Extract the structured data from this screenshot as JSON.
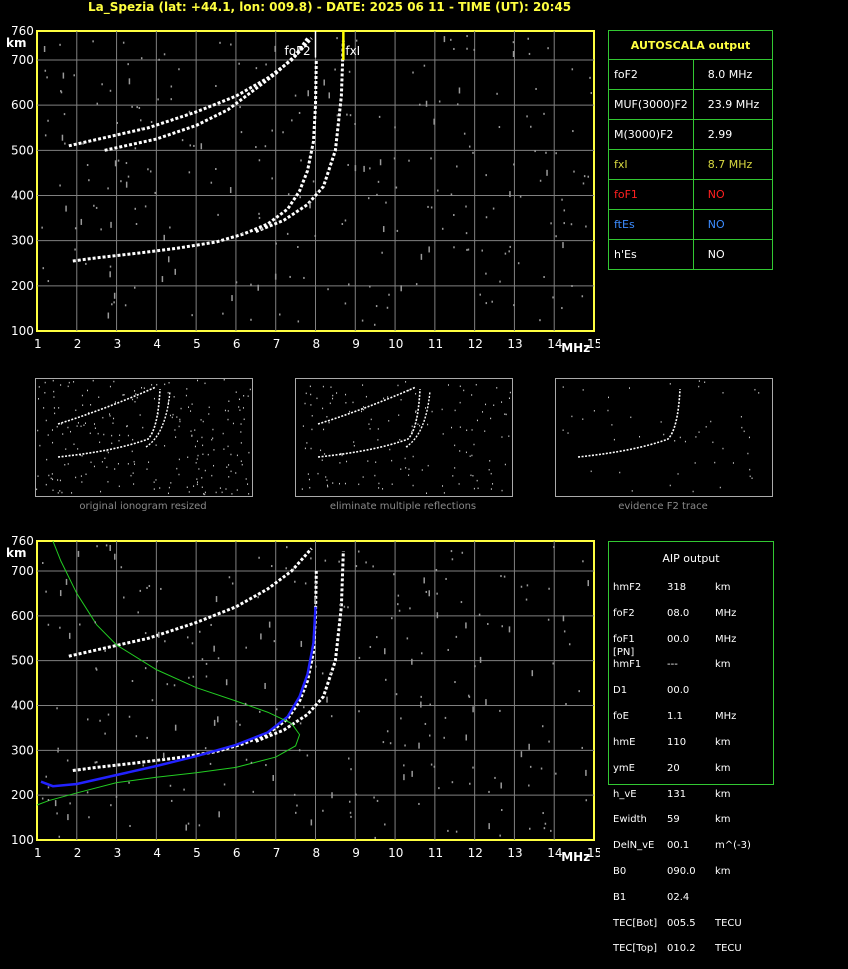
{
  "header": "La_Spezia (lat: +44.1, lon: 009.8) - DATE: 2025 06 11 - TIME (UT): 20:45",
  "axes": {
    "y_unit": "km",
    "x_unit": "MHz",
    "y_ticks": [
      "760",
      "700",
      "600",
      "500",
      "400",
      "300",
      "200",
      "100"
    ],
    "x_ticks": [
      "1",
      "2",
      "3",
      "4",
      "5",
      "6",
      "7",
      "8",
      "9",
      "10",
      "11",
      "12",
      "13",
      "14",
      "15"
    ]
  },
  "chart_data": [
    {
      "type": "scatter",
      "title": "",
      "xlabel": "MHz",
      "ylabel": "km",
      "xlim": [
        1,
        15
      ],
      "ylim": [
        100,
        760
      ],
      "grid": true,
      "markers": {
        "foF2_label": "foF2",
        "fxI_label": "fxI",
        "foF2": 8.0,
        "fxI": 8.7
      },
      "series": [
        {
          "color": "#ffffff",
          "points": [
            [
              1.9,
              255
            ],
            [
              2.5,
              262
            ],
            [
              3.5,
              272
            ],
            [
              4.5,
              283
            ],
            [
              5.5,
              297
            ],
            [
              6.2,
              315
            ],
            [
              6.8,
              337
            ],
            [
              7.3,
              370
            ],
            [
              7.6,
              410
            ],
            [
              7.8,
              455
            ],
            [
              7.95,
              520
            ],
            [
              8.0,
              600
            ],
            [
              8.02,
              700
            ]
          ]
        },
        {
          "color": "#ffffff",
          "points": [
            [
              2.7,
              500
            ],
            [
              4.0,
              525
            ],
            [
              5.0,
              555
            ],
            [
              5.8,
              590
            ],
            [
              6.4,
              630
            ],
            [
              7.0,
              670
            ],
            [
              7.5,
              710
            ],
            [
              7.8,
              745
            ]
          ]
        },
        {
          "color": "#ffffff",
          "points": [
            [
              1.8,
              510
            ],
            [
              2.8,
              530
            ],
            [
              3.8,
              550
            ],
            [
              5.0,
              585
            ],
            [
              6.0,
              620
            ],
            [
              6.8,
              660
            ],
            [
              7.4,
              700
            ],
            [
              7.9,
              745
            ]
          ]
        },
        {
          "color": "#ffffff",
          "points": [
            [
              6.5,
              320
            ],
            [
              7.2,
              345
            ],
            [
              7.8,
              380
            ],
            [
              8.2,
              420
            ],
            [
              8.5,
              500
            ],
            [
              8.65,
              620
            ],
            [
              8.7,
              740
            ]
          ]
        }
      ]
    },
    {
      "type": "line",
      "title": "",
      "xlabel": "MHz",
      "ylabel": "km",
      "xlim": [
        1,
        15
      ],
      "ylim": [
        100,
        760
      ],
      "grid": true,
      "series": [
        {
          "color": "#ffffff",
          "points": [
            [
              1.9,
              255
            ],
            [
              2.5,
              262
            ],
            [
              3.5,
              272
            ],
            [
              4.5,
              283
            ],
            [
              5.5,
              297
            ],
            [
              6.2,
              315
            ],
            [
              6.8,
              337
            ],
            [
              7.3,
              370
            ],
            [
              7.6,
              410
            ],
            [
              7.8,
              455
            ],
            [
              7.95,
              520
            ],
            [
              8.0,
              600
            ],
            [
              8.02,
              700
            ]
          ]
        },
        {
          "color": "#ffffff",
          "points": [
            [
              1.8,
              510
            ],
            [
              2.8,
              530
            ],
            [
              3.8,
              550
            ],
            [
              5.0,
              585
            ],
            [
              6.0,
              620
            ],
            [
              6.8,
              660
            ],
            [
              7.4,
              700
            ],
            [
              7.9,
              745
            ]
          ]
        },
        {
          "color": "#ffffff",
          "points": [
            [
              6.5,
              320
            ],
            [
              7.2,
              345
            ],
            [
              7.8,
              380
            ],
            [
              8.2,
              420
            ],
            [
              8.5,
              500
            ],
            [
              8.65,
              620
            ],
            [
              8.7,
              740
            ]
          ]
        },
        {
          "color": "#2222ff",
          "points": [
            [
              1.1,
              230
            ],
            [
              1.4,
              220
            ],
            [
              2,
              225
            ],
            [
              3,
              245
            ],
            [
              4,
              265
            ],
            [
              5,
              287
            ],
            [
              6,
              312
            ],
            [
              6.8,
              340
            ],
            [
              7.3,
              375
            ],
            [
              7.6,
              420
            ],
            [
              7.8,
              470
            ],
            [
              7.95,
              540
            ],
            [
              8.0,
              620
            ]
          ]
        },
        {
          "color": "#22cc22",
          "points": [
            [
              1.4,
              760
            ],
            [
              1.6,
              720
            ],
            [
              2.0,
              650
            ],
            [
              2.5,
              580
            ],
            [
              3,
              535
            ],
            [
              4,
              480
            ],
            [
              5,
              440
            ],
            [
              6,
              410
            ],
            [
              6.8,
              385
            ],
            [
              7.4,
              360
            ],
            [
              7.6,
              335
            ],
            [
              7.5,
              310
            ],
            [
              7,
              285
            ],
            [
              6,
              262
            ],
            [
              5,
              250
            ],
            [
              4,
              240
            ],
            [
              3,
              228
            ],
            [
              2,
              205
            ],
            [
              1.3,
              188
            ],
            [
              1,
              178
            ]
          ]
        }
      ]
    }
  ],
  "thumbnails": [
    {
      "caption": "original ionogram resized"
    },
    {
      "caption": "eliminate multiple reflections"
    },
    {
      "caption": "evidence F2 trace"
    }
  ],
  "autoscala": {
    "title": "AUTOSCALA output",
    "rows": [
      {
        "label": "foF2",
        "value": "8.0 MHz",
        "color": "#ffffff"
      },
      {
        "label": "MUF(3000)F2",
        "value": "23.9 MHz",
        "color": "#ffffff"
      },
      {
        "label": "M(3000)F2",
        "value": "2.99",
        "color": "#ffffff"
      },
      {
        "label": "fxI",
        "value": "8.7 MHz",
        "color": "#d8d840"
      },
      {
        "label": "foF1",
        "value": "NO",
        "color": "#ff2020"
      },
      {
        "label": "ftEs",
        "value": "NO",
        "color": "#3c8cff"
      },
      {
        "label": "h'Es",
        "value": "NO",
        "color": "#ffffff"
      }
    ]
  },
  "aip": {
    "title": "AIP output",
    "rows": [
      [
        "hmF2",
        "318",
        "km",
        ""
      ],
      [
        "foF2",
        "08.0",
        "MHz",
        ""
      ],
      [
        "foF1",
        "00.0",
        "MHz",
        "[PN]"
      ],
      [
        "hmF1",
        "---",
        "km",
        ""
      ],
      [
        "D1",
        "00.0",
        "",
        ""
      ],
      [
        "foE",
        "1.1",
        "MHz",
        ""
      ],
      [
        "hmE",
        "110",
        "km",
        ""
      ],
      [
        "ymE",
        "20",
        "km",
        ""
      ],
      [
        "h_vE",
        "131",
        "km",
        ""
      ],
      [
        "Ewidth",
        "59",
        "km",
        ""
      ],
      [
        "DelN_vE",
        "00.1",
        "m^(-3)",
        ""
      ],
      [
        "B0",
        "090.0",
        "km",
        ""
      ],
      [
        "B1",
        "02.4",
        "",
        ""
      ],
      [
        "TEC[Bot]",
        "005.5",
        "TECU",
        ""
      ],
      [
        "TEC[Top]",
        "010.2",
        "TECU",
        ""
      ]
    ]
  },
  "colors": {
    "grid": "#808080",
    "frame": "#ffff40",
    "panel_border": "#32c832",
    "accent_header": "#ffff40"
  }
}
